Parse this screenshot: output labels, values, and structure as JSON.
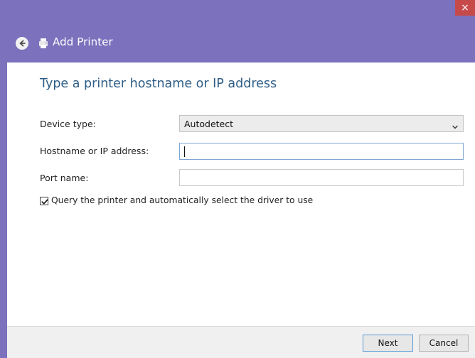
{
  "window": {
    "title": "Add Printer",
    "close_glyph": "×",
    "colors": {
      "titlebar": "#7b71bd",
      "close_button": "#c74a4a",
      "heading": "#2e5d86"
    }
  },
  "icons": {
    "back": "back-arrow-icon",
    "printer": "printer-icon",
    "dropdown": "chevron-down-icon",
    "check": "checkmark-icon"
  },
  "main": {
    "heading": "Type a printer hostname or IP address",
    "device_type": {
      "label": "Device type:",
      "selected": "Autodetect"
    },
    "hostname": {
      "label": "Hostname or IP address:",
      "value": ""
    },
    "port": {
      "label": "Port name:",
      "value": ""
    },
    "query_checkbox": {
      "label": "Query the printer and automatically select the driver to use",
      "checked": true
    }
  },
  "footer": {
    "next_label": "Next",
    "cancel_label": "Cancel"
  }
}
